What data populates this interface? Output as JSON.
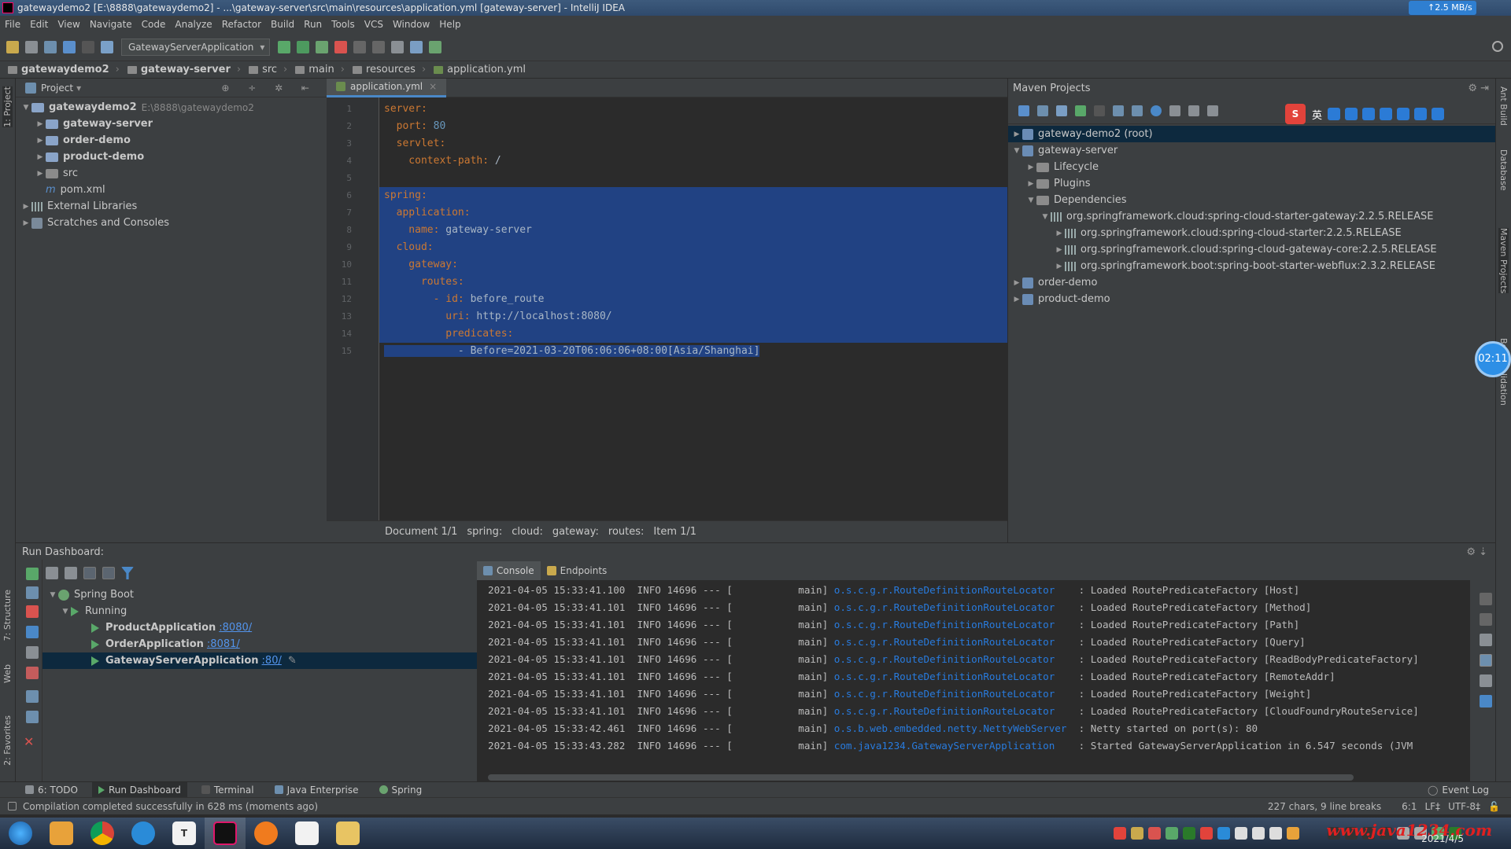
{
  "window": {
    "title": "gatewaydemo2 [E:\\8888\\gatewaydemo2] - ...\\gateway-server\\src\\main\\resources\\application.yml [gateway-server] - IntelliJ IDEA",
    "net_speed": "↑2.5 MB/s"
  },
  "menu": [
    "File",
    "Edit",
    "View",
    "Navigate",
    "Code",
    "Analyze",
    "Refactor",
    "Build",
    "Run",
    "Tools",
    "VCS",
    "Window",
    "Help"
  ],
  "toolbar": {
    "run_config": "GatewayServerApplication"
  },
  "breadcrumb": [
    "gatewaydemo2",
    "gateway-server",
    "src",
    "main",
    "resources",
    "application.yml"
  ],
  "project": {
    "header": "Project",
    "root": {
      "name": "gatewaydemo2",
      "path": "E:\\8888\\gatewaydemo2"
    },
    "children": [
      "gateway-server",
      "order-demo",
      "product-demo",
      "src",
      "pom.xml"
    ],
    "external": "External Libraries",
    "scratches": "Scratches and Consoles"
  },
  "editor": {
    "tab": "application.yml",
    "lines": [
      {
        "n": "1",
        "key": "server:",
        "val": ""
      },
      {
        "n": "2",
        "key": "  port:",
        "val": " 80"
      },
      {
        "n": "3",
        "key": "  servlet:",
        "val": ""
      },
      {
        "n": "4",
        "key": "    context-path:",
        "val": " /"
      },
      {
        "n": "5",
        "key": "",
        "val": ""
      },
      {
        "n": "6",
        "key": "spring:",
        "val": ""
      },
      {
        "n": "7",
        "key": "  application:",
        "val": ""
      },
      {
        "n": "8",
        "key": "    name:",
        "val": " gateway-server"
      },
      {
        "n": "9",
        "key": "  cloud:",
        "val": ""
      },
      {
        "n": "10",
        "key": "    gateway:",
        "val": ""
      },
      {
        "n": "11",
        "key": "      routes:",
        "val": ""
      },
      {
        "n": "12",
        "key": "        - id:",
        "val": " before_route"
      },
      {
        "n": "13",
        "key": "          uri:",
        "val": " http://localhost:8080/"
      },
      {
        "n": "14",
        "key": "          predicates:",
        "val": ""
      },
      {
        "n": "15",
        "key": "",
        "val": "            - Before=2021-03-20T06:06:06+08:00[Asia/Shanghai]"
      }
    ],
    "crumbs": [
      "Document 1/1",
      "spring:",
      "cloud:",
      "gateway:",
      "routes:",
      "Item 1/1"
    ]
  },
  "maven": {
    "header": "Maven Projects",
    "items": [
      {
        "label": "gateway-demo2 (root)"
      },
      {
        "label": "gateway-server"
      },
      {
        "label": "Lifecycle"
      },
      {
        "label": "Plugins"
      },
      {
        "label": "Dependencies"
      },
      {
        "label": "org.springframework.cloud:spring-cloud-starter-gateway:2.2.5.RELEASE"
      },
      {
        "label": "org.springframework.cloud:spring-cloud-starter:2.2.5.RELEASE"
      },
      {
        "label": "org.springframework.cloud:spring-cloud-gateway-core:2.2.5.RELEASE"
      },
      {
        "label": "org.springframework.boot:spring-boot-starter-webflux:2.3.2.RELEASE"
      },
      {
        "label": "order-demo"
      },
      {
        "label": "product-demo"
      }
    ],
    "ime_label": "英",
    "clock": "02:11"
  },
  "dashboard": {
    "header": "Run Dashboard:",
    "group": "Spring Boot",
    "running": "Running",
    "apps": [
      {
        "name": "ProductApplication",
        "port": ":8080/"
      },
      {
        "name": "OrderApplication",
        "port": ":8081/"
      },
      {
        "name": "GatewayServerApplication",
        "port": ":80/"
      }
    ],
    "tabs": [
      "Console",
      "Endpoints"
    ],
    "logs": [
      {
        "pre": "2021-04-05 15:33:41.100  INFO 14696 --- [           main] ",
        "logger": "o.s.c.g.r.RouteDefinitionRouteLocator   ",
        "msg": " : Loaded RoutePredicateFactory [Host]"
      },
      {
        "pre": "2021-04-05 15:33:41.101  INFO 14696 --- [           main] ",
        "logger": "o.s.c.g.r.RouteDefinitionRouteLocator   ",
        "msg": " : Loaded RoutePredicateFactory [Method]"
      },
      {
        "pre": "2021-04-05 15:33:41.101  INFO 14696 --- [           main] ",
        "logger": "o.s.c.g.r.RouteDefinitionRouteLocator   ",
        "msg": " : Loaded RoutePredicateFactory [Path]"
      },
      {
        "pre": "2021-04-05 15:33:41.101  INFO 14696 --- [           main] ",
        "logger": "o.s.c.g.r.RouteDefinitionRouteLocator   ",
        "msg": " : Loaded RoutePredicateFactory [Query]"
      },
      {
        "pre": "2021-04-05 15:33:41.101  INFO 14696 --- [           main] ",
        "logger": "o.s.c.g.r.RouteDefinitionRouteLocator   ",
        "msg": " : Loaded RoutePredicateFactory [ReadBodyPredicateFactory]"
      },
      {
        "pre": "2021-04-05 15:33:41.101  INFO 14696 --- [           main] ",
        "logger": "o.s.c.g.r.RouteDefinitionRouteLocator   ",
        "msg": " : Loaded RoutePredicateFactory [RemoteAddr]"
      },
      {
        "pre": "2021-04-05 15:33:41.101  INFO 14696 --- [           main] ",
        "logger": "o.s.c.g.r.RouteDefinitionRouteLocator   ",
        "msg": " : Loaded RoutePredicateFactory [Weight]"
      },
      {
        "pre": "2021-04-05 15:33:41.101  INFO 14696 --- [           main] ",
        "logger": "o.s.c.g.r.RouteDefinitionRouteLocator   ",
        "msg": " : Loaded RoutePredicateFactory [CloudFoundryRouteService]"
      },
      {
        "pre": "2021-04-05 15:33:42.461  INFO 14696 --- [           main] ",
        "logger": "o.s.b.web.embedded.netty.NettyWebServer ",
        "msg": " : Netty started on port(s): 80"
      },
      {
        "pre": "2021-04-05 15:33:43.282  INFO 14696 --- [           main] ",
        "logger": "com.java1234.GatewayServerApplication   ",
        "msg": " : Started GatewayServerApplication in 6.547 seconds (JVM"
      }
    ]
  },
  "bottom_tabs": [
    "6: TODO",
    "Run Dashboard",
    "Terminal",
    "Java Enterprise",
    "Spring"
  ],
  "event_log": "Event Log",
  "status": {
    "message": "Compilation completed successfully in 628 ms (moments ago)",
    "chars": "227 chars, 9 line breaks",
    "position": "6:1",
    "line_sep": "LF‡",
    "encoding": "UTF-8‡"
  },
  "taskbar": {
    "watermark": "www.java1234.com",
    "date": "2021/4/5"
  },
  "left_stripe": [
    "1: Project",
    "7: Structure",
    "Web",
    "2: Favorites"
  ],
  "right_stripe": [
    "Ant Build",
    "Database",
    "Maven Projects",
    "Bean Validation"
  ]
}
